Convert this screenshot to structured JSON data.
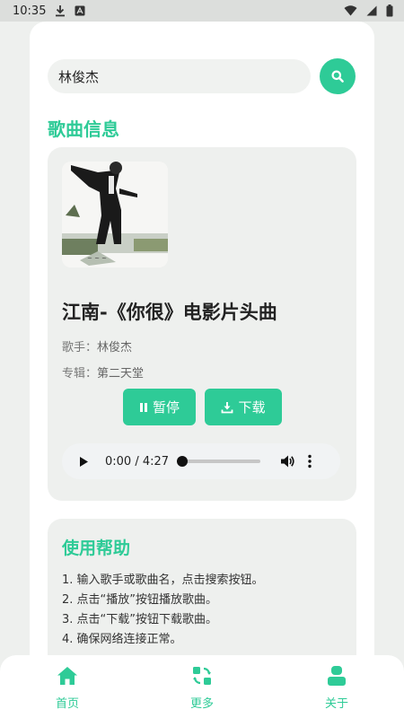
{
  "status_bar": {
    "time": "10:35",
    "icons": [
      "download-icon",
      "notification-a-icon",
      "wifi-icon",
      "signal-icon",
      "battery-icon"
    ]
  },
  "search": {
    "value": "林俊杰",
    "button_icon": "search-icon"
  },
  "song_section": {
    "title": "歌曲信息",
    "song_title": "江南-《你很》电影片头曲",
    "singer_label": "歌手：",
    "singer": "林俊杰",
    "album_label": "专辑：",
    "album": "第二天堂",
    "pause_label": "暂停",
    "download_label": "下载"
  },
  "player": {
    "time": "0:00 / 4:27",
    "progress": 0
  },
  "help": {
    "title": "使用帮助",
    "items": [
      "1. 输入歌手或歌曲名，点击搜索按钮。",
      "2. 点击“播放”按钮播放歌曲。",
      "3. 点击“下载”按钮下载歌曲。",
      "4. 确保网络连接正常。"
    ]
  },
  "nav": {
    "home": "首页",
    "more": "更多",
    "about": "关于"
  },
  "colors": {
    "accent": "#2ecb97",
    "card_bg": "#eef0ee"
  }
}
